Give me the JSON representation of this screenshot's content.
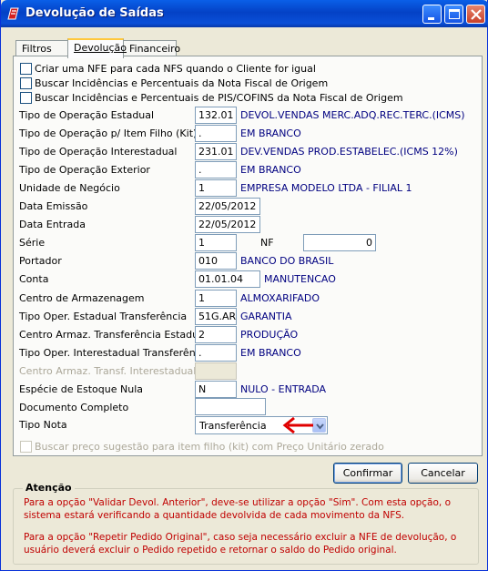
{
  "window": {
    "title": "Devolução de Saídas"
  },
  "tabs": [
    "Filtros",
    "Devolução",
    "Financeiro"
  ],
  "checkboxes": [
    "Criar uma NFE para cada NFS quando o Cliente for igual",
    "Buscar Incidências e Percentuais da Nota Fiscal de Origem",
    "Buscar Incidências e Percentuais de PIS/COFINS da Nota Fiscal de Origem"
  ],
  "form": {
    "tipo_op_estadual": {
      "label": "Tipo de Operação Estadual",
      "value": "132.01",
      "desc": "DEVOL.VENDAS MERC.ADQ.REC.TERC.(ICMS)"
    },
    "tipo_op_item_filho": {
      "label": "Tipo de Operação p/ Item Filho (Kit)",
      "value": ".",
      "desc": "EM BRANCO"
    },
    "tipo_op_interestadual": {
      "label": "Tipo de Operação Interestadual",
      "value": "231.01",
      "desc": "DEV.VENDAS PROD.ESTABELEC.(ICMS 12%)"
    },
    "tipo_op_exterior": {
      "label": "Tipo de Operação Exterior",
      "value": ".",
      "desc": "EM BRANCO"
    },
    "unidade_negocio": {
      "label": "Unidade de Negócio",
      "value": "1",
      "desc": "EMPRESA MODELO LTDA - FILIAL 1"
    },
    "data_emissao": {
      "label": "Data Emissão",
      "value": "22/05/2012"
    },
    "data_entrada": {
      "label": "Data Entrada",
      "value": "22/05/2012"
    },
    "serie": {
      "label": "Série",
      "value": "1"
    },
    "nf": {
      "label": "NF",
      "value": "0"
    },
    "portador": {
      "label": "Portador",
      "value": "010",
      "desc": "BANCO DO BRASIL"
    },
    "conta": {
      "label": "Conta",
      "value": "01.01.04",
      "desc": "MANUTENCAO"
    },
    "centro_armazenagem": {
      "label": "Centro de Armazenagem",
      "value": "1",
      "desc": "ALMOXARIFADO"
    },
    "tipo_oper_est_transf": {
      "label": "Tipo Oper. Estadual Transferência",
      "value": "51G.AR",
      "desc": "GARANTIA"
    },
    "centro_armaz_transf_est": {
      "label": "Centro Armaz. Transferência Estadual",
      "value": "2",
      "desc": "PRODUÇÃO"
    },
    "tipo_oper_inter_transf": {
      "label": "Tipo Oper. Interestadual Transferência",
      "value": ".",
      "desc": "EM BRANCO"
    },
    "centro_armaz_transf_inter": {
      "label": "Centro Armaz. Transf. Interestadual",
      "value": ""
    },
    "especie_estoque_nula": {
      "label": "Espécie de Estoque Nula",
      "value": "N",
      "desc": "NULO - ENTRADA"
    },
    "documento_completo": {
      "label": "Documento Completo",
      "value": ""
    },
    "tipo_nota": {
      "label": "Tipo Nota",
      "value": "Transferência"
    }
  },
  "checkbox_disabled": "Buscar preço sugestão para item filho (kit) com Preço Unitário zerado",
  "buttons": {
    "confirm": "Confirmar",
    "cancel": "Cancelar"
  },
  "attention": {
    "title": "Atenção",
    "p1": "Para a opção \"Validar Devol. Anterior\", deve-se utilizar a opção \"Sim\". Com esta opção, o sistema estará verificando a quantidade devolvida de cada movimento da NFS.",
    "p2": "Para a opção \"Repetir Pedido Original\", caso seja necessário excluir a NFE de devolução, o usuário deverá excluir o Pedido repetido e retornar o saldo do Pedido original."
  },
  "colors": {
    "titlebar": "#0442c6",
    "desc_text": "#000080",
    "warning_text": "#c00000",
    "arrow": "#e00000"
  }
}
